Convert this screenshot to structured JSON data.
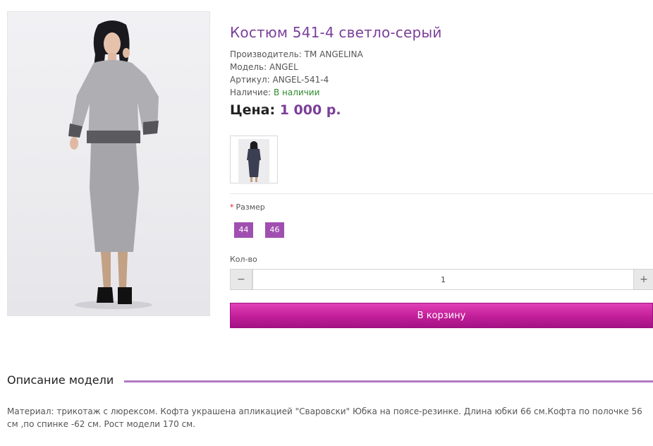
{
  "product": {
    "title": "Костюм 541-4 светло-серый",
    "manufacturer_label": "Производитель:",
    "manufacturer": "ТМ ANGELINA",
    "model_label": "Модель:",
    "model": "ANGEL",
    "sku_label": "Артикул:",
    "sku": "ANGEL-541-4",
    "availability_label": "Наличие:",
    "availability": "В наличии",
    "price_label": "Цена:",
    "price": "1 000 р."
  },
  "options": {
    "size_label": "Размер",
    "sizes": [
      "44",
      "46"
    ]
  },
  "quantity": {
    "label": "Кол-во",
    "value": "1",
    "minus": "−",
    "plus": "+"
  },
  "cart": {
    "button_label": "В корзину"
  },
  "description": {
    "heading": "Описание модели",
    "text": "Материал: трикотаж с люрексом. Кофта украшена апликацией \"Сваровски\" Юбка на поясе-резинке. Длина юбки 66 см.Кофта по полочке 56 см ,по спинке -62 см. Рост модели 170 см."
  },
  "colors": {
    "accent": "#7b3f9a",
    "size_button": "#a04fb0",
    "cart_button": "#c21e99",
    "in_stock": "#2e8b2e",
    "divider_accent": "#b27ac3"
  }
}
